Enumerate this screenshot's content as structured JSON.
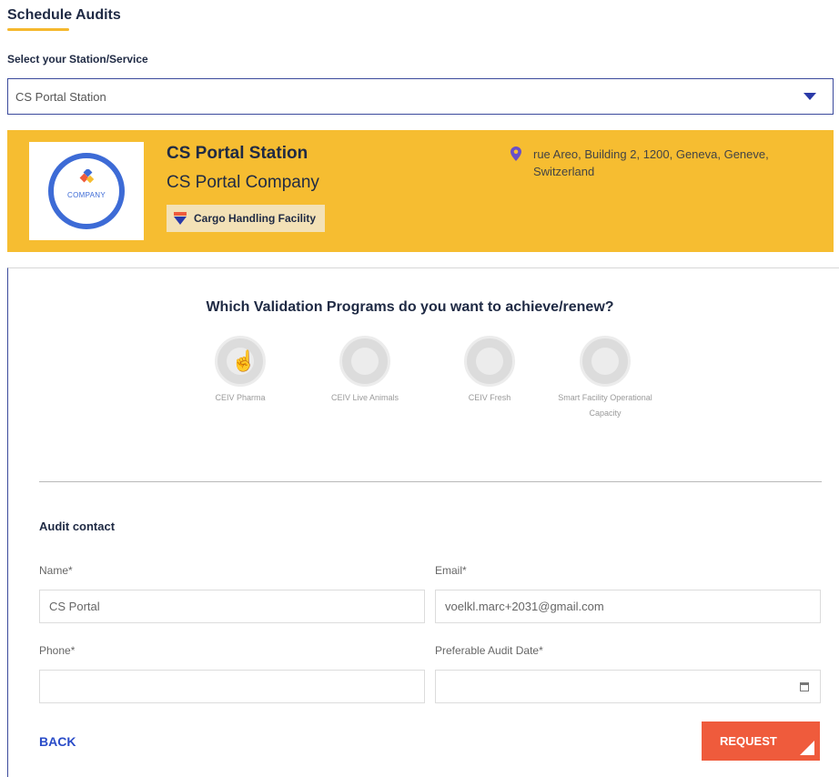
{
  "page": {
    "title": "Schedule Audits",
    "select_label": "Select your Station/Service"
  },
  "station_select": {
    "value": "CS Portal Station"
  },
  "station_card": {
    "station_name": "CS Portal Station",
    "company_name": "CS Portal Company",
    "facility_type": "Cargo Handling Facility",
    "address": "rue Areo, Building 2, 1200, Geneva, Geneve, Switzerland",
    "logo_text": "COMPANY",
    "background_color": "#f6bd31"
  },
  "programs": {
    "question": "Which Validation Programs do you want to achieve/renew?",
    "items": [
      {
        "label": "CEIV Pharma",
        "icon": "ceiv-pharma-seal-icon"
      },
      {
        "label": "CEIV Live Animals",
        "icon": "ceiv-live-animals-seal-icon"
      },
      {
        "label": "CEIV Fresh",
        "icon": "ceiv-fresh-seal-icon"
      },
      {
        "label": "Smart Facility Operational Capacity",
        "icon": "smart-facility-seal-icon"
      }
    ]
  },
  "audit_contact": {
    "heading": "Audit contact",
    "name_label": "Name*",
    "name_value": "CS Portal",
    "email_label": "Email*",
    "email_value": "voelkl.marc+2031@gmail.com",
    "phone_label": "Phone*",
    "phone_value": "",
    "date_label": "Preferable Audit Date*",
    "date_value": ""
  },
  "actions": {
    "back_label": "BACK",
    "request_label": "REQUEST",
    "request_color": "#ef5b3c"
  }
}
